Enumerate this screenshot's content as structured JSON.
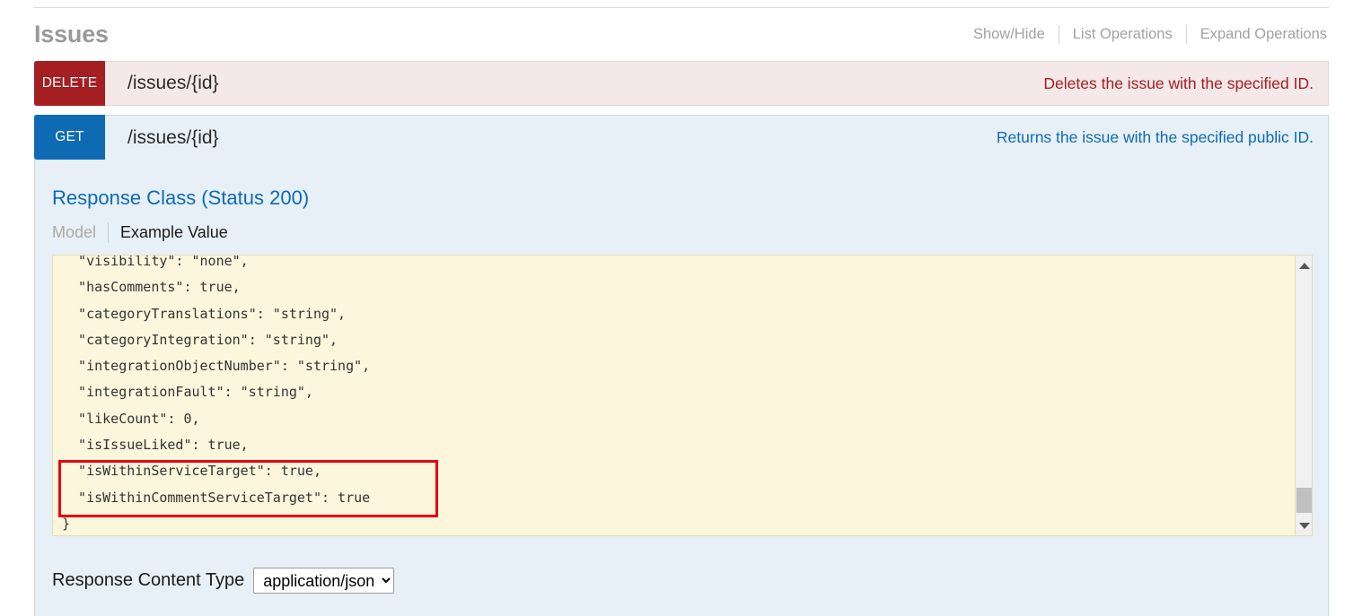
{
  "resource": {
    "title": "Issues",
    "options": [
      "Show/Hide",
      "List Operations",
      "Expand Operations"
    ]
  },
  "operations": [
    {
      "method": "DELETE",
      "path": "/issues/{id}",
      "description": "Deletes the issue with the specified ID.",
      "color": "#a41e22"
    },
    {
      "method": "GET",
      "path": "/issues/{id}",
      "description": "Returns the issue with the specified public ID.",
      "color": "#0f6ab4"
    }
  ],
  "response": {
    "class_title": "Response Class (Status 200)",
    "tabs": [
      {
        "label": "Model",
        "active": false
      },
      {
        "label": "Example Value",
        "active": true
      }
    ],
    "example_value": "  \"visibility\": \"none\",\n  \"hasComments\": true,\n  \"categoryTranslations\": \"string\",\n  \"categoryIntegration\": \"string\",\n  \"integrationObjectNumber\": \"string\",\n  \"integrationFault\": \"string\",\n  \"likeCount\": 0,\n  \"isIssueLiked\": true,\n  \"isWithinServiceTarget\": true,\n  \"isWithinCommentServiceTarget\": true\n}",
    "content_type_label": "Response Content Type",
    "content_type_value": "application/json",
    "content_type_options": [
      "application/json"
    ]
  },
  "annotation": {
    "highlight_color": "#e8000c",
    "highlighted_lines": [
      "\"isWithinServiceTarget\": true,",
      "\"isWithinCommentServiceTarget\": true"
    ]
  },
  "scrollbar": {
    "up_arrow": "scroll-up",
    "down_arrow": "scroll-down"
  }
}
